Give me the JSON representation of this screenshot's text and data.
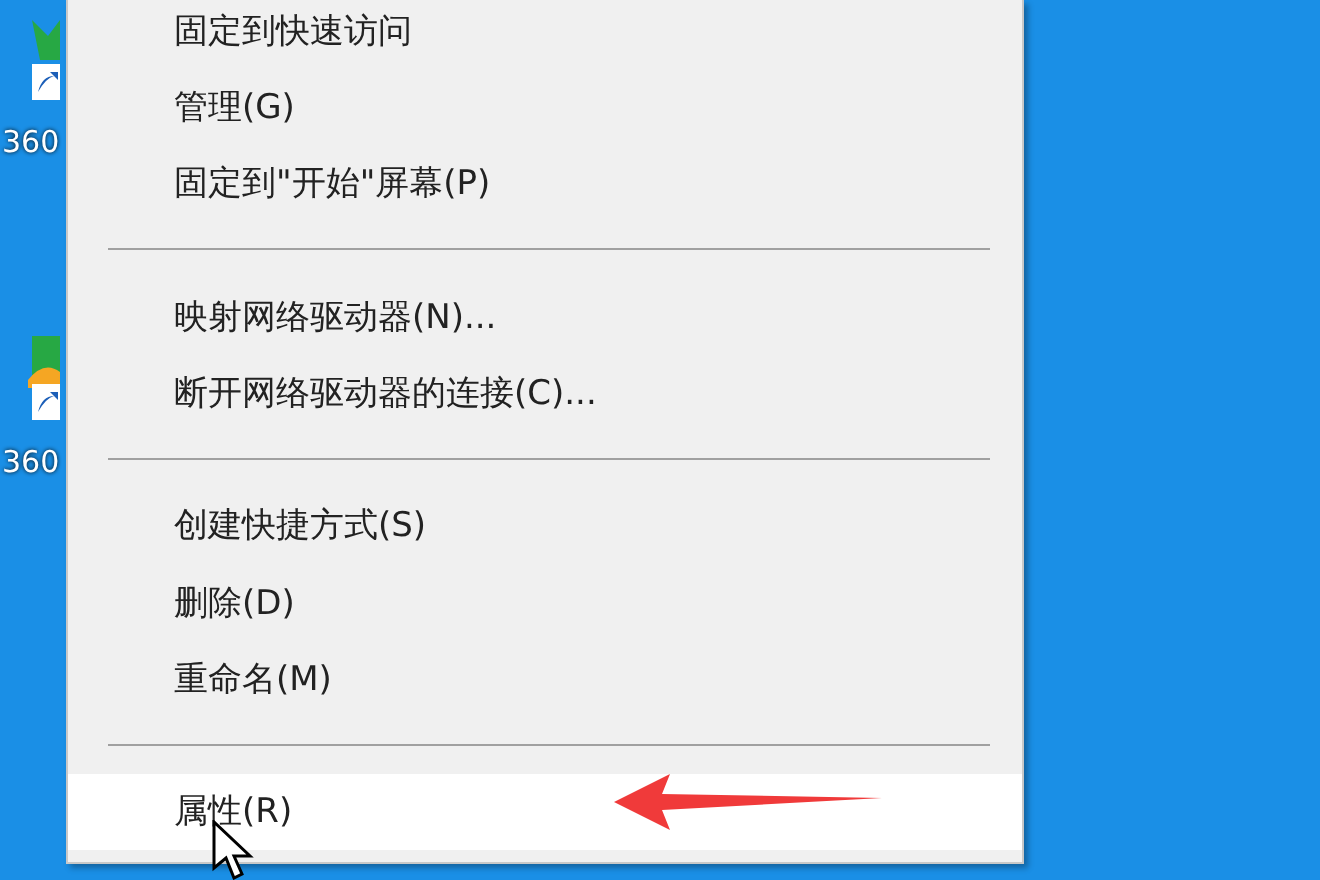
{
  "desktop_icons": [
    {
      "label": "360"
    },
    {
      "label": "360"
    }
  ],
  "context_menu": {
    "groups": [
      [
        {
          "label": "固定到快速访问",
          "selected": false
        },
        {
          "label": "管理(G)",
          "selected": false
        },
        {
          "label": "固定到\"开始\"屏幕(P)",
          "selected": false
        }
      ],
      [
        {
          "label": "映射网络驱动器(N)...",
          "selected": false
        },
        {
          "label": "断开网络驱动器的连接(C)...",
          "selected": false
        }
      ],
      [
        {
          "label": "创建快捷方式(S)",
          "selected": false
        },
        {
          "label": "删除(D)",
          "selected": false
        },
        {
          "label": "重命名(M)",
          "selected": false
        }
      ],
      [
        {
          "label": "属性(R)",
          "selected": true
        }
      ]
    ]
  }
}
